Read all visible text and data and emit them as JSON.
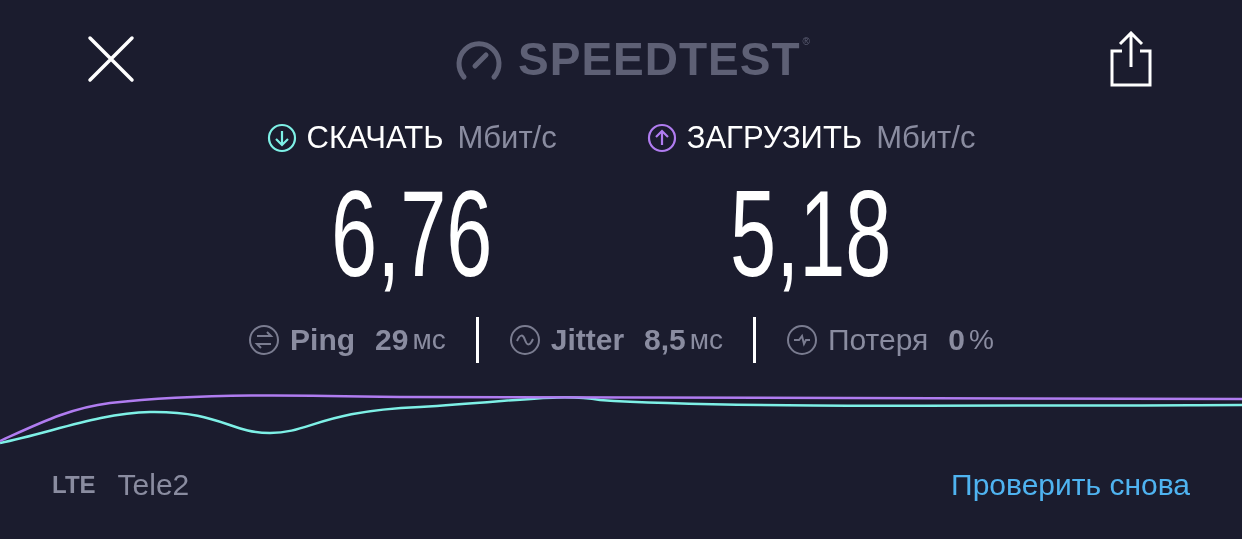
{
  "header": {
    "logo": "SPEEDTEST",
    "trademark": "®"
  },
  "results": [
    {
      "kind": "download",
      "label": "СКАЧАТЬ",
      "unit": "Мбит/с",
      "value": "6,76",
      "color": "#7ef0e6"
    },
    {
      "kind": "upload",
      "label": "ЗАГРУЗИТЬ",
      "unit": "Мбит/с",
      "value": "5,18",
      "color": "#b07cf0"
    }
  ],
  "stats": [
    {
      "kind": "ping",
      "label": "Ping",
      "value": "29",
      "unit": "мс"
    },
    {
      "kind": "jitter",
      "label": "Jitter",
      "value": "8,5",
      "unit": "мс"
    },
    {
      "kind": "loss",
      "label": "Потеря",
      "value": "0",
      "unit": "%"
    }
  ],
  "footer": {
    "network": "LTE",
    "carrier": "Tele2",
    "retry": "Проверить снова"
  }
}
